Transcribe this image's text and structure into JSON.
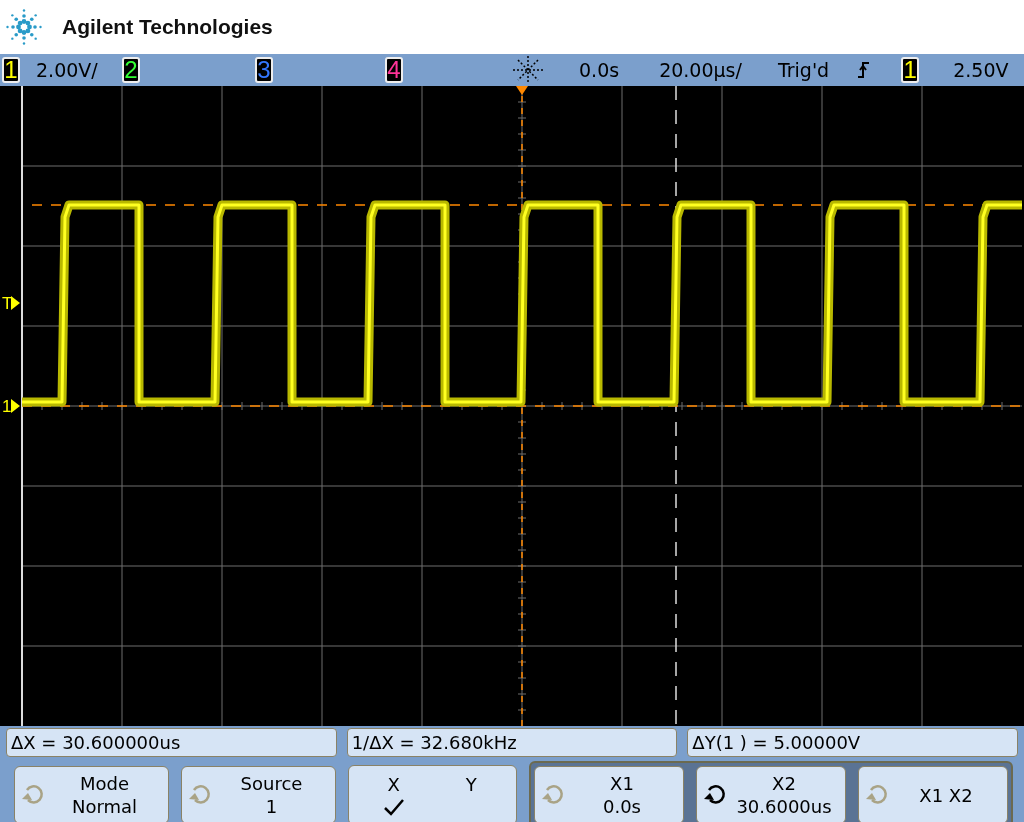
{
  "header": {
    "brand": "Agilent Technologies"
  },
  "channel_bar": {
    "channels": [
      {
        "number": "1",
        "scale": "2.00V/"
      },
      {
        "number": "2"
      },
      {
        "number": "3"
      },
      {
        "number": "4"
      }
    ],
    "delay": "0.0s",
    "timebase": "20.00µs/",
    "trigger_status": "Trig'd",
    "trigger_source": {
      "number": "1"
    },
    "trigger_level": "2.50V"
  },
  "markers": [
    {
      "label": "T"
    },
    {
      "label": "1"
    }
  ],
  "measurements": [
    "ΔX = 30.600000us",
    "1/ΔX = 32.680kHz",
    "ΔY(1 ) = 5.00000V"
  ],
  "softkeys": [
    {
      "kind": "knob",
      "label": "Mode",
      "value": "Normal",
      "active": false
    },
    {
      "kind": "knob",
      "label": "Source",
      "value": "1",
      "active": false
    },
    {
      "kind": "choice",
      "options": [
        {
          "label": "X",
          "selected": true
        },
        {
          "label": "Y",
          "selected": false
        }
      ]
    }
  ],
  "cursor_keys": [
    {
      "kind": "knob",
      "label": "X1",
      "value": "0.0s",
      "active": false
    },
    {
      "kind": "knob",
      "label": "X2",
      "value": "30.6000us",
      "active": true
    },
    {
      "kind": "knob",
      "label": "X1 X2",
      "active": false
    }
  ]
}
